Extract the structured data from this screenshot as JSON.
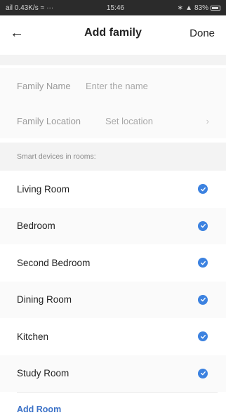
{
  "status_bar": {
    "left_text": "ail 0.43K/s",
    "time": "15:46",
    "battery_text": "83%"
  },
  "nav": {
    "title": "Add family",
    "done_label": "Done"
  },
  "form": {
    "family_name_label": "Family Name",
    "family_name_placeholder": "Enter the name",
    "family_location_label": "Family Location",
    "family_location_value": "Set location"
  },
  "rooms_section": {
    "header": "Smart devices in rooms:",
    "rooms": [
      {
        "label": "Living Room",
        "checked": true
      },
      {
        "label": "Bedroom",
        "checked": true
      },
      {
        "label": "Second Bedroom",
        "checked": true
      },
      {
        "label": "Dining Room",
        "checked": true
      },
      {
        "label": "Kitchen",
        "checked": true
      },
      {
        "label": "Study Room",
        "checked": true
      }
    ],
    "add_room_label": "Add Room"
  },
  "colors": {
    "accent": "#3c82e0",
    "link": "#3c72c8"
  },
  "icons": {
    "back": "arrow-left-icon",
    "chevron": "chevron-right-icon",
    "check": "check-circle-icon"
  }
}
